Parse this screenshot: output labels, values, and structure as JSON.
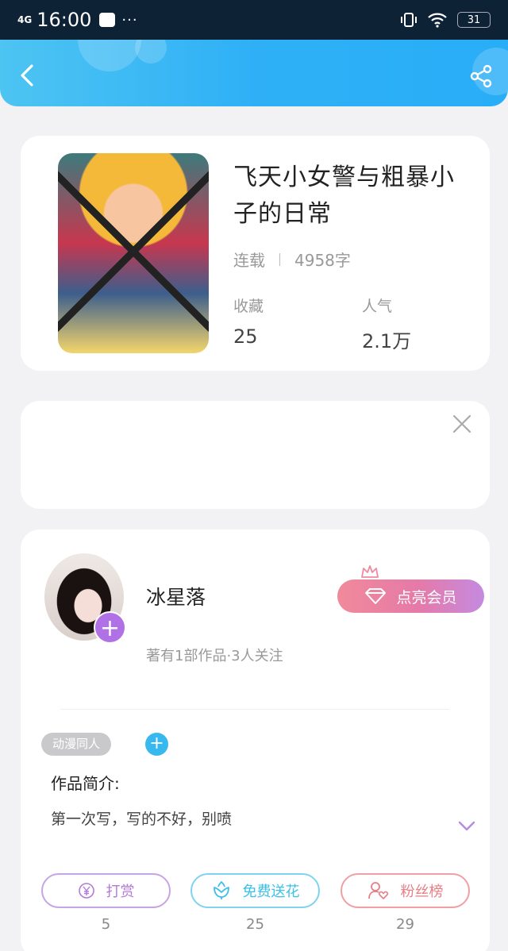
{
  "status_bar": {
    "network": "4G",
    "time": "16:00",
    "dots": "···",
    "battery": "31"
  },
  "book": {
    "title": "飞天小女警与粗暴小子的日常",
    "status": "连载",
    "word_count": "4958字",
    "stats": [
      {
        "label": "收藏",
        "value": "25"
      },
      {
        "label": "人气",
        "value": "2.1万"
      }
    ]
  },
  "author": {
    "name": "冰星落",
    "subtitle": "著有1部作品·3人关注",
    "vip_label": "点亮会员",
    "follow_symbol": "+"
  },
  "tags": [
    {
      "label": "动漫同人"
    }
  ],
  "tag_add_symbol": "+",
  "intro": {
    "title": "作品简介:",
    "text": "第一次写，写的不好，别喷"
  },
  "actions": [
    {
      "label": "打赏",
      "count": "5",
      "color": "#b37ad9",
      "icon": "yen-coin-icon"
    },
    {
      "label": "免费送花",
      "count": "25",
      "color": "#3cc0e8",
      "icon": "flower-icon"
    },
    {
      "label": "粉丝榜",
      "count": "29",
      "color": "#e77f86",
      "icon": "fans-icon"
    }
  ],
  "colors": {
    "header": "#2fb0f6",
    "accent_purple": "#b070e6",
    "tag_add": "#37b8ee"
  }
}
